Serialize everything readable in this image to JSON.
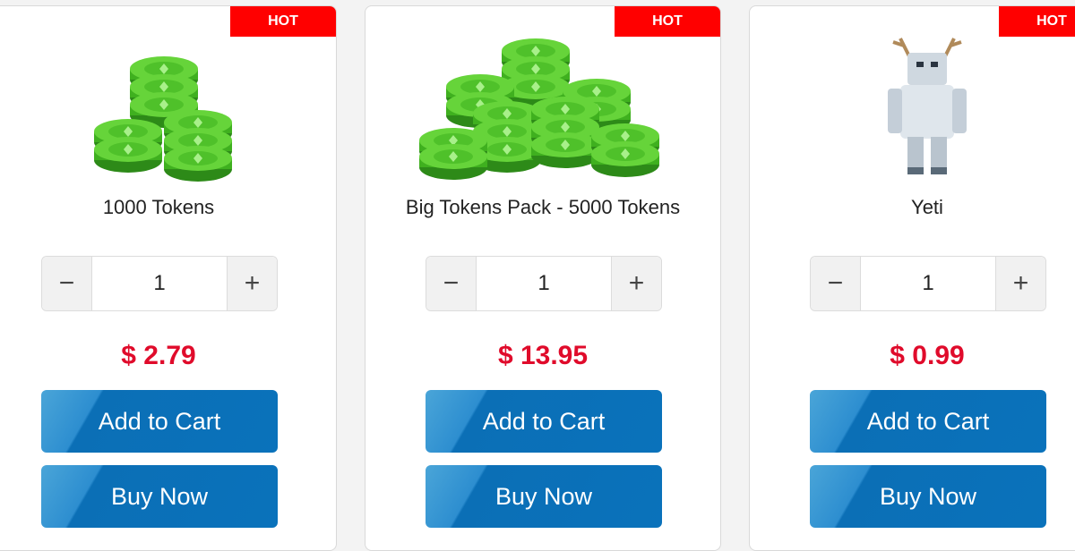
{
  "products": [
    {
      "badge": "HOT",
      "name": "1000 Tokens",
      "quantity": "1",
      "price": "$ 2.79",
      "add_to_cart": "Add to Cart",
      "buy_now": "Buy Now",
      "image": "tokens-small-icon"
    },
    {
      "badge": "HOT",
      "name": "Big Tokens Pack - 5000 Tokens",
      "quantity": "1",
      "price": "$ 13.95",
      "add_to_cart": "Add to Cart",
      "buy_now": "Buy Now",
      "image": "tokens-large-icon"
    },
    {
      "badge": "HOT",
      "name": "Yeti",
      "quantity": "1",
      "price": "$ 0.99",
      "add_to_cart": "Add to Cart",
      "buy_now": "Buy Now",
      "image": "yeti-icon"
    }
  ],
  "stepper": {
    "minus": "−",
    "plus": "+"
  },
  "colors": {
    "hot_badge": "#ff0000",
    "price": "#e00b2b",
    "button": "#0a72bb"
  }
}
